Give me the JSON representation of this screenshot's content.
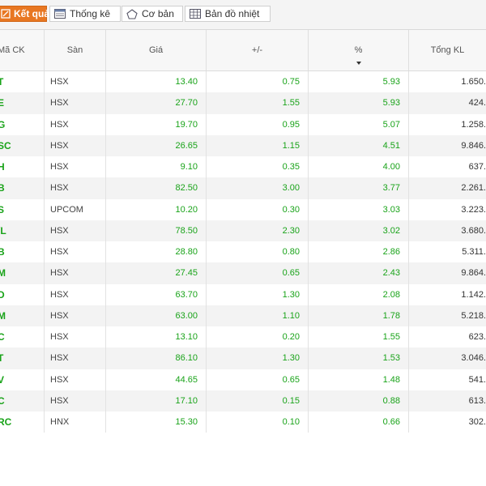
{
  "tabs": [
    {
      "label": "Kết quả",
      "icon": "result-icon",
      "active": true
    },
    {
      "label": "Thống kê",
      "icon": "table-stats-icon",
      "active": false
    },
    {
      "label": "Cơ bản",
      "icon": "pentagon-icon",
      "active": false
    },
    {
      "label": "Bản đồ nhiệt",
      "icon": "heatmap-grid-icon",
      "active": false
    }
  ],
  "columns": {
    "symbol": "Mã CK",
    "exchange": "Sàn",
    "price": "Giá",
    "change": "+/-",
    "percent": "%",
    "volume": "Tổng KL"
  },
  "sort": {
    "column": "percent",
    "direction": "desc"
  },
  "colors": {
    "up": "#19a319",
    "accent": "#e87722"
  },
  "rows": [
    {
      "symbol": "T",
      "exchange": "HSX",
      "price": "13.40",
      "change": "0.75",
      "percent": "5.93",
      "volume": "1.650."
    },
    {
      "symbol": "E",
      "exchange": "HSX",
      "price": "27.70",
      "change": "1.55",
      "percent": "5.93",
      "volume": "424."
    },
    {
      "symbol": "G",
      "exchange": "HSX",
      "price": "19.70",
      "change": "0.95",
      "percent": "5.07",
      "volume": "1.258."
    },
    {
      "symbol": "SC",
      "exchange": "HSX",
      "price": "26.65",
      "change": "1.15",
      "percent": "4.51",
      "volume": "9.846."
    },
    {
      "symbol": "H",
      "exchange": "HSX",
      "price": "9.10",
      "change": "0.35",
      "percent": "4.00",
      "volume": "637."
    },
    {
      "symbol": "B",
      "exchange": "HSX",
      "price": "82.50",
      "change": "3.00",
      "percent": "3.77",
      "volume": "2.261."
    },
    {
      "symbol": "S",
      "exchange": "UPCOM",
      "price": "10.20",
      "change": "0.30",
      "percent": "3.03",
      "volume": "3.223."
    },
    {
      "symbol": "/L",
      "exchange": "HSX",
      "price": "78.50",
      "change": "2.30",
      "percent": "3.02",
      "volume": "3.680."
    },
    {
      "symbol": "B",
      "exchange": "HSX",
      "price": "28.80",
      "change": "0.80",
      "percent": "2.86",
      "volume": "5.311."
    },
    {
      "symbol": "M",
      "exchange": "HSX",
      "price": "27.45",
      "change": "0.65",
      "percent": "2.43",
      "volume": "9.864."
    },
    {
      "symbol": "D",
      "exchange": "HSX",
      "price": "63.70",
      "change": "1.30",
      "percent": "2.08",
      "volume": "1.142."
    },
    {
      "symbol": "M",
      "exchange": "HSX",
      "price": "63.00",
      "change": "1.10",
      "percent": "1.78",
      "volume": "5.218."
    },
    {
      "symbol": "C",
      "exchange": "HSX",
      "price": "13.10",
      "change": "0.20",
      "percent": "1.55",
      "volume": "623."
    },
    {
      "symbol": "T",
      "exchange": "HSX",
      "price": "86.10",
      "change": "1.30",
      "percent": "1.53",
      "volume": "3.046."
    },
    {
      "symbol": "V",
      "exchange": "HSX",
      "price": "44.65",
      "change": "0.65",
      "percent": "1.48",
      "volume": "541."
    },
    {
      "symbol": "C",
      "exchange": "HSX",
      "price": "17.10",
      "change": "0.15",
      "percent": "0.88",
      "volume": "613."
    },
    {
      "symbol": "RC",
      "exchange": "HNX",
      "price": "15.30",
      "change": "0.10",
      "percent": "0.66",
      "volume": "302."
    }
  ]
}
